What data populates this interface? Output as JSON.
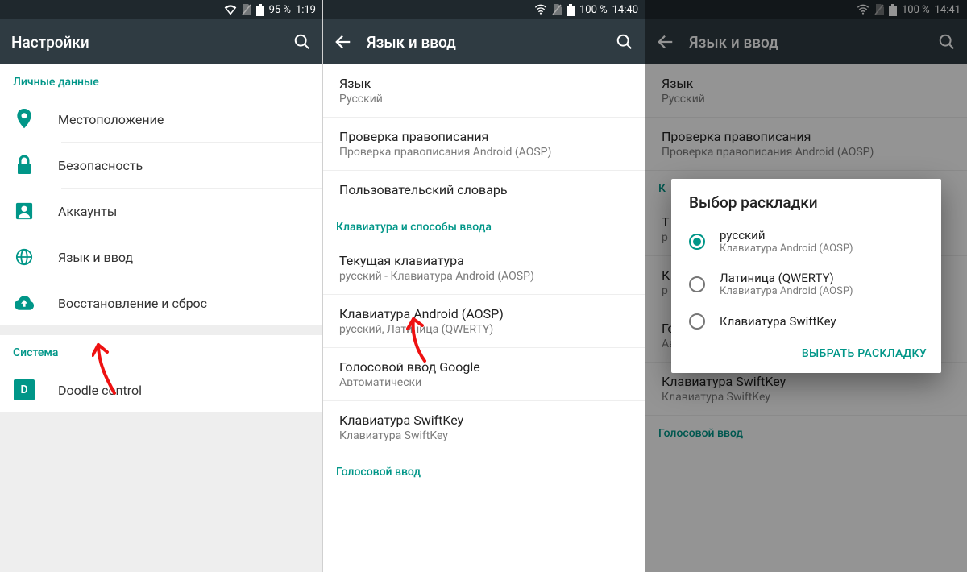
{
  "pane1": {
    "status": {
      "battery": "95 %",
      "time": "1:19"
    },
    "title": "Настройки",
    "section_personal": "Личные данные",
    "items": [
      {
        "label": "Местоположение"
      },
      {
        "label": "Безопасность"
      },
      {
        "label": "Аккаунты"
      },
      {
        "label": "Язык и ввод"
      },
      {
        "label": "Восстановление и сброс"
      }
    ],
    "section_system": "Система",
    "system_items": [
      {
        "label": "Doodle control",
        "badge": "D"
      }
    ]
  },
  "pane2": {
    "status": {
      "battery": "100 %",
      "time": "14:40"
    },
    "title": "Язык и ввод",
    "items": [
      {
        "t": "Язык",
        "s": "Русский"
      },
      {
        "t": "Проверка правописания",
        "s": "Проверка правописания Android (AOSP)"
      },
      {
        "t": "Пользовательский словарь"
      }
    ],
    "section_kbd": "Клавиатура и способы ввода",
    "kbd_items": [
      {
        "t": "Текущая клавиатура",
        "s": "русский - Клавиатура Android (AOSP)"
      },
      {
        "t": "Клавиатура Android (AOSP)",
        "s": "русский, Латиница (QWERTY)"
      },
      {
        "t": "Голосовой ввод Google",
        "s": "Автоматически"
      },
      {
        "t": "Клавиатура SwiftKey",
        "s": "Клавиатура SwiftKey"
      }
    ],
    "section_voice": "Голосовой ввод"
  },
  "pane3": {
    "status": {
      "battery": "100 %",
      "time": "14:41"
    },
    "title": "Язык и ввод",
    "items": [
      {
        "t": "Язык",
        "s": "Русский"
      },
      {
        "t": "Проверка правописания",
        "s": "Проверка правописания Android (AOSP)"
      }
    ],
    "section_kbd": "К",
    "kbd_items": [
      {
        "t": "Т",
        "s": "р"
      },
      {
        "t": "К",
        "s": "р"
      },
      {
        "t": "Голосовой ввод Google",
        "s": "Автоматически"
      },
      {
        "t": "Клавиатура SwiftKey",
        "s": "Клавиатура SwiftKey"
      }
    ],
    "section_voice": "Голосовой ввод",
    "dialog": {
      "title": "Выбор раскладки",
      "options": [
        {
          "t": "русский",
          "s": "Клавиатура Android (AOSP)",
          "selected": true
        },
        {
          "t": "Латиница (QWERTY)",
          "s": "Клавиатура Android (AOSP)",
          "selected": false
        },
        {
          "t": "Клавиатура SwiftKey",
          "selected": false
        }
      ],
      "action": "ВЫБРАТЬ РАСКЛАДКУ"
    }
  }
}
